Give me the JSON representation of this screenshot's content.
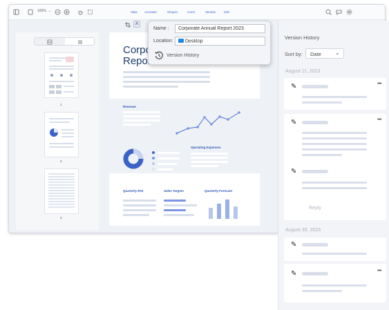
{
  "toolbar": {
    "zoom": "100%",
    "tabs": [
      "View",
      "Annotate",
      "Shapes",
      "Insert",
      "Version",
      "Edit"
    ],
    "active_tab": "Version"
  },
  "thumbnails": {
    "page_numbers": [
      "1",
      "2",
      "3"
    ]
  },
  "document": {
    "title_line1": "Corporate Annual",
    "title_line2": "Report 2023",
    "revenue_label": "Revenue",
    "opex_label": "Operating Expenses",
    "roi_label": "Quarterly ROI",
    "targets_label": "Sales Targets",
    "forecast_label": "Quarterly Forecast"
  },
  "save_popup": {
    "name_label": "Name :",
    "name_value": "Corporate Annual Report 2023",
    "location_label": "Location:",
    "location_value": "Desktop",
    "version_history_label": "Version History"
  },
  "version_panel": {
    "title": "Version History",
    "sort_label": "Sort by:",
    "sort_value": "Date",
    "groups": [
      "August 11, 2023",
      "August 30, 2023"
    ],
    "reply_label": "Reply",
    "more_label": "•••"
  },
  "colors": {
    "accent": "#2f5bd8",
    "title_navy": "#1e3a6d",
    "placeholder": "#d7deea",
    "pdf_red": "#e2323b"
  }
}
